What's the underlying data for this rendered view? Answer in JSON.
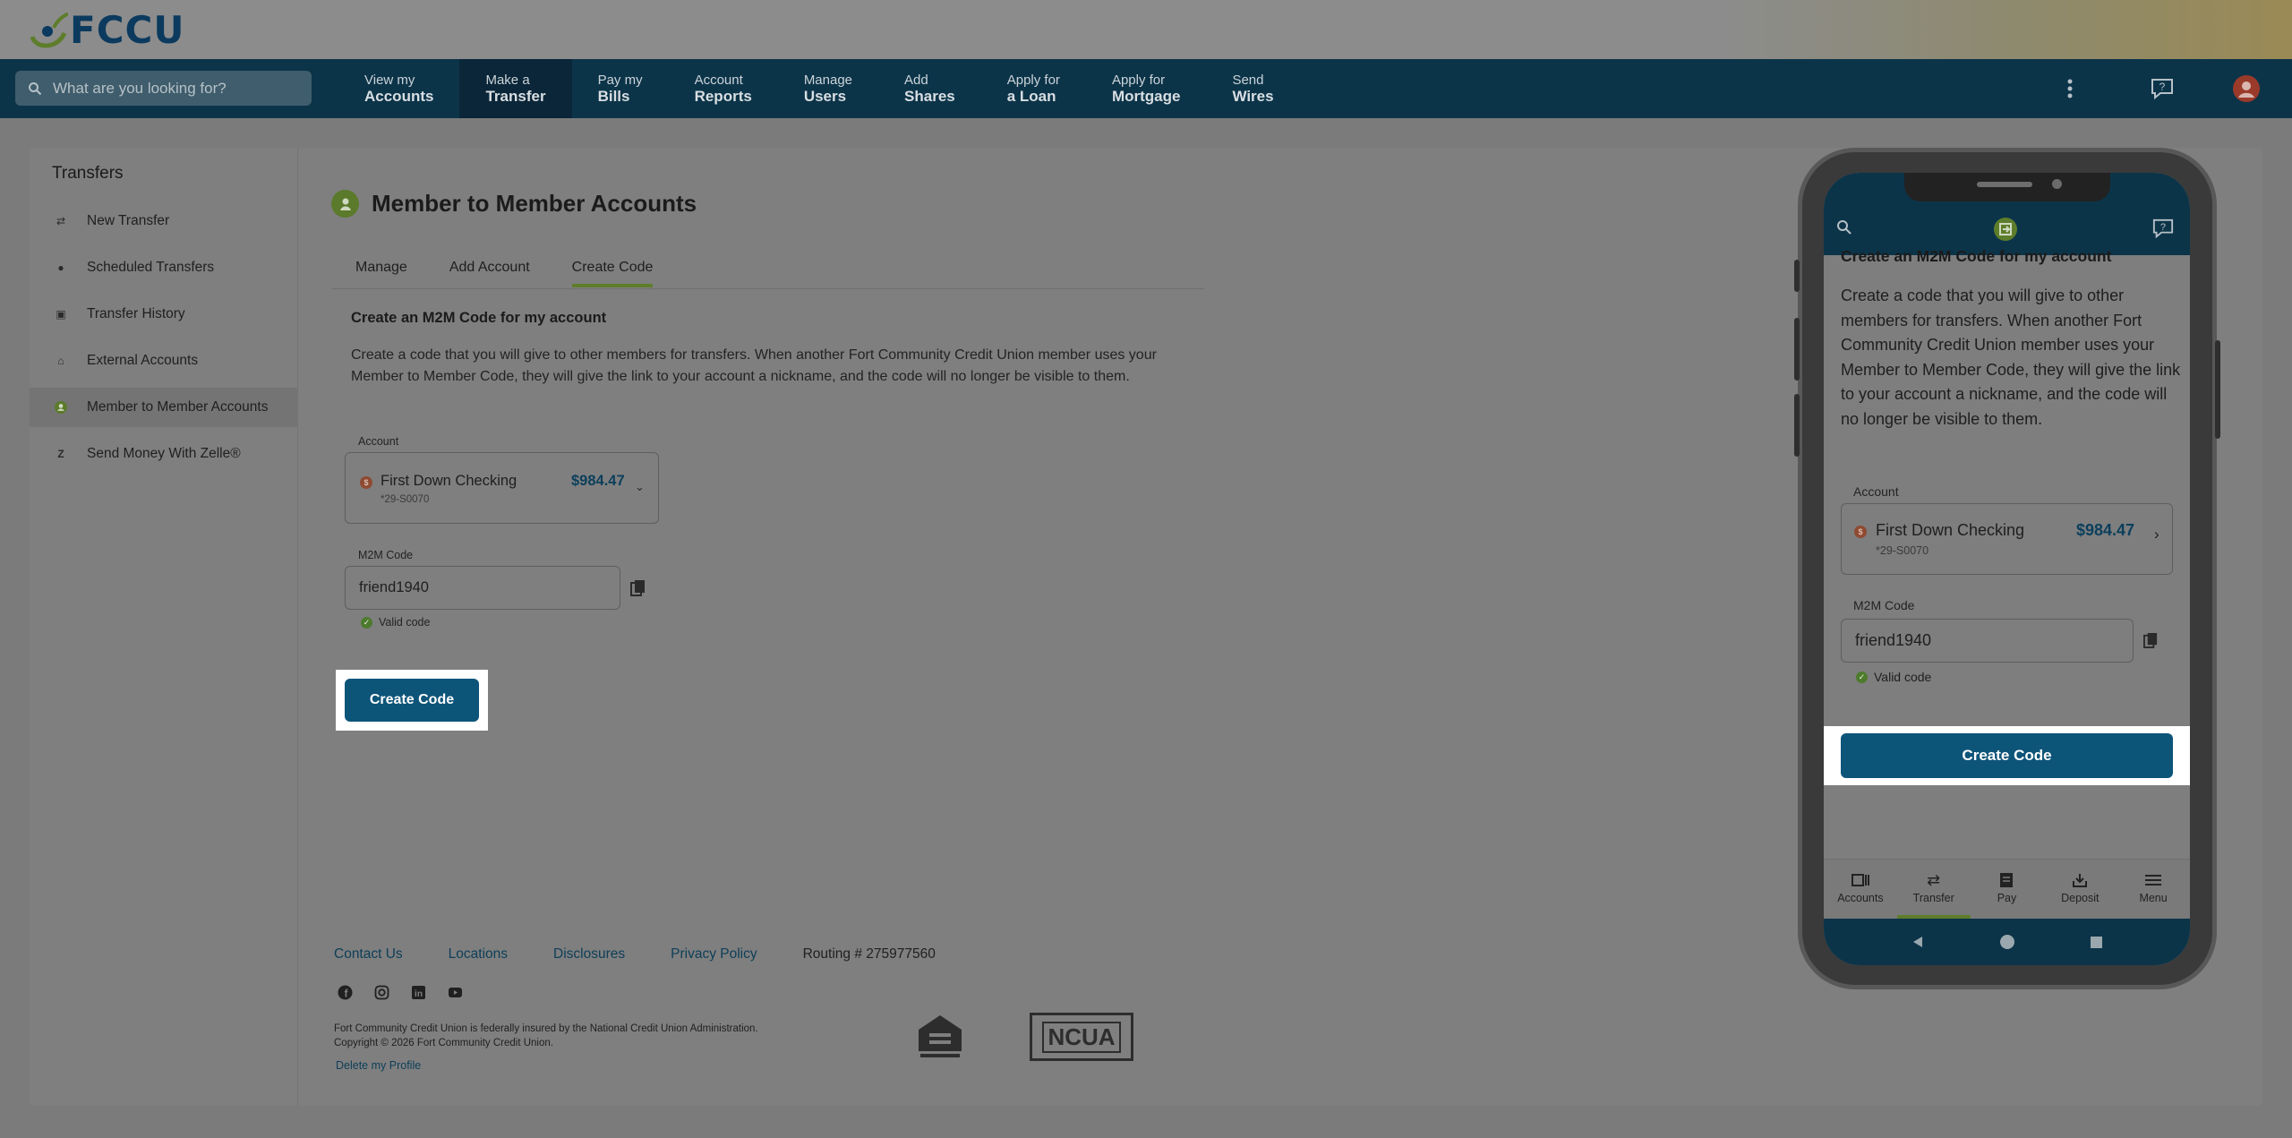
{
  "brand": {
    "name": "FCCU"
  },
  "search": {
    "placeholder": "What are you looking for?"
  },
  "nav": {
    "items": [
      {
        "top": "View my",
        "bottom": "Accounts"
      },
      {
        "top": "Make a",
        "bottom": "Transfer"
      },
      {
        "top": "Pay my",
        "bottom": "Bills"
      },
      {
        "top": "Account",
        "bottom": "Reports"
      },
      {
        "top": "Manage",
        "bottom": "Users"
      },
      {
        "top": "Add",
        "bottom": "Shares"
      },
      {
        "top": "Apply for",
        "bottom": "a Loan"
      },
      {
        "top": "Apply for",
        "bottom": "Mortgage"
      },
      {
        "top": "Send",
        "bottom": "Wires"
      }
    ],
    "active_index": 1
  },
  "sidebar": {
    "title": "Transfers",
    "items": [
      {
        "label": "New Transfer",
        "icon": "arrows-swap-icon"
      },
      {
        "label": "Scheduled Transfers",
        "icon": "clock-icon"
      },
      {
        "label": "Transfer History",
        "icon": "calendar-icon"
      },
      {
        "label": "External Accounts",
        "icon": "bank-icon"
      },
      {
        "label": "Member to Member Accounts",
        "icon": "member-icon"
      },
      {
        "label": "Send Money With Zelle®",
        "icon": "zelle-icon"
      }
    ],
    "active_index": 4
  },
  "page": {
    "title": "Member to Member Accounts",
    "tabs": [
      "Manage",
      "Add Account",
      "Create Code"
    ],
    "active_tab": "Create Code",
    "section_title": "Create an M2M Code for my account",
    "description": "Create a code that you will give to other members for transfers. When another Fort Community Credit Union member uses your Member to Member Code, they will give the link to your account a nickname, and the code will no longer be visible to them.",
    "account_label": "Account",
    "account": {
      "name": "First Down Checking",
      "number": "*29-S0070",
      "balance": "$984.47",
      "badge": "$"
    },
    "code_label": "M2M Code",
    "code_value": "friend1940",
    "valid_text": "Valid code",
    "button_label": "Create Code"
  },
  "footer": {
    "links": [
      "Contact Us",
      "Locations",
      "Disclosures",
      "Privacy Policy"
    ],
    "routing": "Routing # 275977560",
    "legal_line1": "Fort Community Credit Union is federally insured by the National Credit Union Administration.",
    "legal_line2": "Copyright © 2026 Fort Community Credit Union.",
    "delete_profile": "Delete my Profile",
    "ncua": "NCUA",
    "social": [
      "facebook-icon",
      "instagram-icon",
      "linkedin-icon",
      "youtube-icon"
    ]
  },
  "mobile": {
    "section_title": "Create an M2M Code for my account",
    "description": "Create a code that you will give to other members for transfers. When another Fort Community Credit Union member uses your Member to Member Code, they will give the link to your account a nickname, and the code will no longer be visible to them.",
    "account_label": "Account",
    "account": {
      "name": "First Down Checking",
      "number": "*29-S0070",
      "balance": "$984.47"
    },
    "code_label": "M2M Code",
    "code_value": "friend1940",
    "valid_text": "Valid code",
    "button_label": "Create Code",
    "bottom_nav": [
      "Accounts",
      "Transfer",
      "Pay",
      "Deposit",
      "Menu"
    ],
    "bottom_active": "Transfer"
  },
  "colors": {
    "accent_green": "#5e7d2b",
    "brand_blue": "#0d5479",
    "nav_bg": "#0c3449"
  }
}
